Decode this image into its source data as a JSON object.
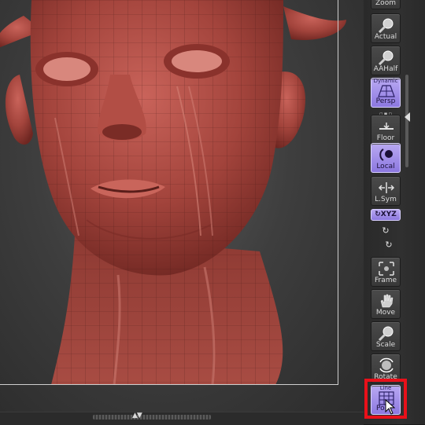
{
  "viewport": {
    "subject": "sculpted head model",
    "mesh_color": "#a8423a",
    "background": "#3e3e3e"
  },
  "right_panel": {
    "tools": [
      {
        "id": "zoom",
        "label": "Zoom",
        "icon": "magnifier-icon",
        "active": false
      },
      {
        "id": "actual",
        "label": "Actual",
        "icon": "magnifier-icon",
        "active": false
      },
      {
        "id": "aahalf",
        "label": "AAHalf",
        "icon": "magnifier-icon",
        "active": false
      },
      {
        "id": "persp",
        "label": "Persp",
        "sublabel": "Dynamic",
        "icon": "grid-perspective-icon",
        "active": true
      },
      {
        "id": "floor",
        "label": "Floor",
        "icon": "floor-icon",
        "active": false
      },
      {
        "id": "local",
        "label": "Local",
        "icon": "local-rotate-icon",
        "active": true
      },
      {
        "id": "lsym",
        "label": "L.Sym",
        "icon": "symmetry-icon",
        "active": false
      },
      {
        "id": "xyz",
        "label": "XYZ",
        "icon": "axis-icon",
        "active": true
      },
      {
        "id": "frame",
        "label": "Frame",
        "icon": "frame-icon",
        "active": false
      },
      {
        "id": "move",
        "label": "Move",
        "icon": "hand-icon",
        "active": false
      },
      {
        "id": "scale",
        "label": "Scale",
        "icon": "magnifier-icon",
        "active": false
      },
      {
        "id": "rotate",
        "label": "Rotate",
        "icon": "rotate-icon",
        "active": false
      },
      {
        "id": "polyf",
        "label": "PolyF",
        "sublabel": "Line",
        "icon": "polyframe-icon",
        "active": true
      }
    ],
    "polyf_visible_label": "Po",
    "colors": {
      "active": "#a898ec",
      "highlight": "#e8101a"
    }
  }
}
